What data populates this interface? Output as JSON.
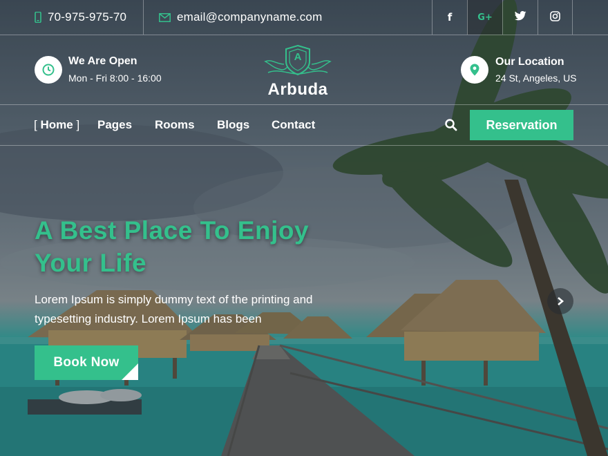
{
  "topbar": {
    "phone": "70-975-975-70",
    "email": "email@companyname.com",
    "social": [
      "facebook-icon",
      "google-plus-icon",
      "twitter-icon",
      "instagram-icon"
    ],
    "social_glyphs": {
      "facebook": "f",
      "google_plus": "G+"
    },
    "active_social": "google-plus"
  },
  "header": {
    "open_title": "We Are Open",
    "open_hours": "Mon - Fri 8:00 - 16:00",
    "logo_letter": "A",
    "logo_text": "Arbuda",
    "location_title": "Our Location",
    "location_address": "24 St, Angeles, US"
  },
  "nav": {
    "items": [
      {
        "label": "Home",
        "active": true
      },
      {
        "label": "Pages"
      },
      {
        "label": "Rooms"
      },
      {
        "label": "Blogs"
      },
      {
        "label": "Contact"
      }
    ],
    "active_bracket_open": "[",
    "active_bracket_close": "]",
    "reservation_label": "Reservation"
  },
  "hero": {
    "title_line1": "A Best Place To Enjoy",
    "title_line2": "Your Life",
    "text_line1": "Lorem Ipsum is simply dummy text of the printing and",
    "text_line2": "typesetting industry. Lorem Ipsum has been",
    "button_label": "Book Now"
  },
  "colors": {
    "accent": "#34c08c",
    "text": "#ffffff"
  }
}
